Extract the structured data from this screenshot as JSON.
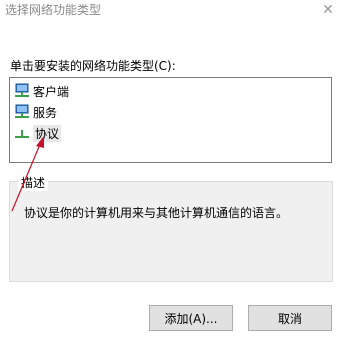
{
  "window": {
    "title": "选择网络功能类型",
    "close_icon": "close-icon"
  },
  "prompt": "单击要安装的网络功能类型(C):",
  "list": {
    "items": [
      {
        "label": "客户端",
        "icon": "client-network-icon"
      },
      {
        "label": "服务",
        "icon": "service-network-icon"
      },
      {
        "label": "协议",
        "icon": "protocol-network-icon",
        "selected": true
      }
    ]
  },
  "description": {
    "legend": "描述",
    "text": "协议是你的计算机用来与其他计算机通信的语言。"
  },
  "buttons": {
    "add": "添加(A)...",
    "cancel": "取消"
  },
  "colors": {
    "annotation_arrow": "#c8102e",
    "monitor_blue": "#2e7bd6",
    "network_green": "#3aa14a"
  }
}
